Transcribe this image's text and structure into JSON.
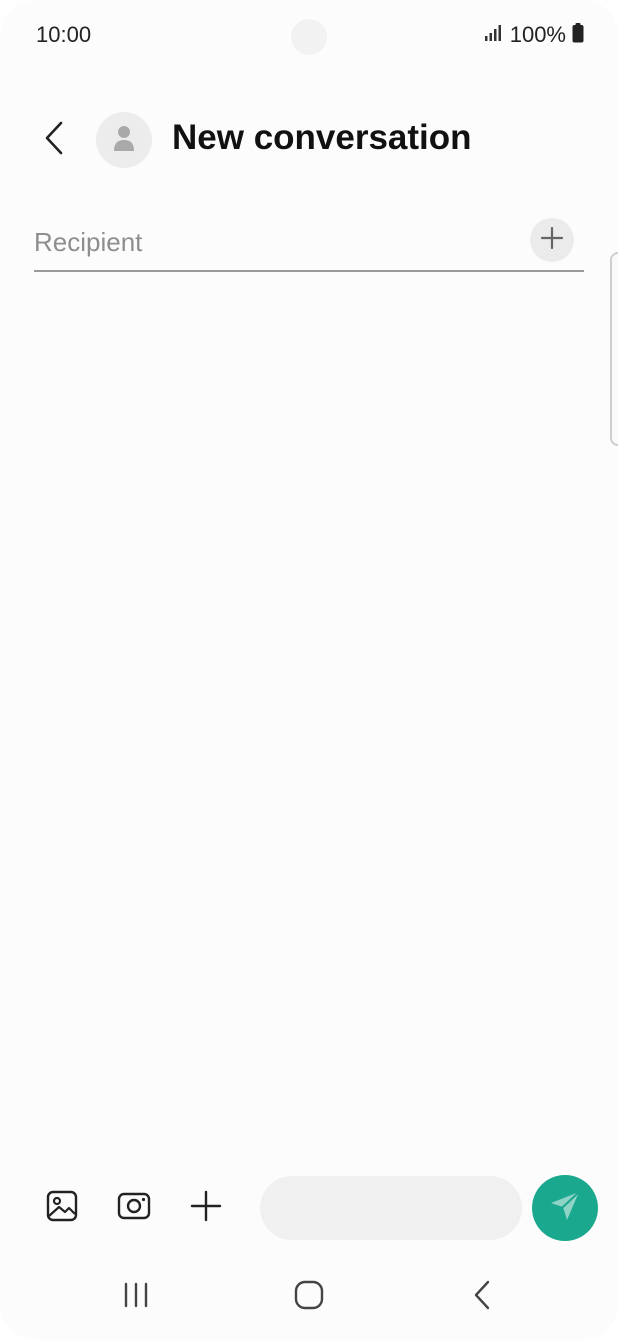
{
  "status_bar": {
    "time": "10:00",
    "battery": "100%",
    "icons": [
      "signal-icon",
      "battery-icon"
    ]
  },
  "header": {
    "title": "New conversation",
    "back_icon": "chevron-left-icon",
    "avatar_icon": "person-icon"
  },
  "recipient": {
    "placeholder": "Recipient",
    "value": "",
    "add_icon": "plus-icon"
  },
  "composer": {
    "tools": [
      "gallery-icon",
      "camera-icon",
      "plus-icon"
    ],
    "message_placeholder": "",
    "send_icon": "send-icon"
  },
  "nav_bar": {
    "buttons": [
      "recent-apps-icon",
      "home-icon",
      "back-icon"
    ]
  },
  "colors": {
    "accent": "#1aa88e",
    "background": "#fcfcfc",
    "input_background": "#f0f0f0"
  }
}
